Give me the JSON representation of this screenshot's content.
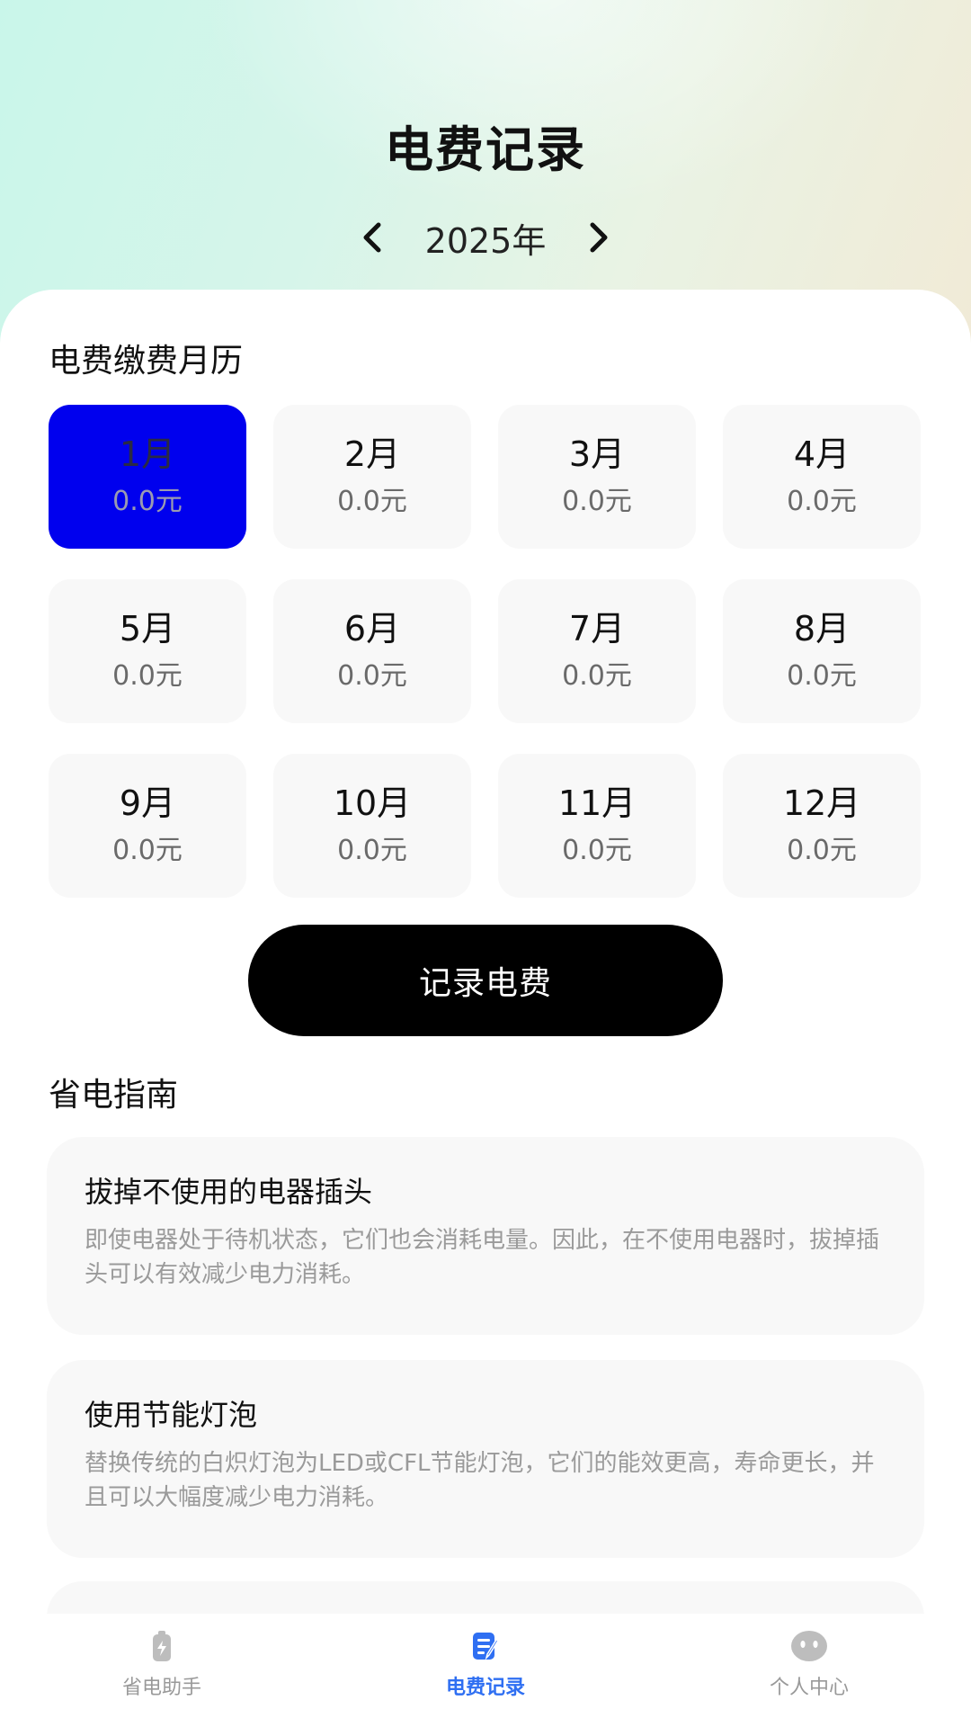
{
  "header": {
    "title": "电费记录",
    "year": "2025年"
  },
  "calendar": {
    "section_title": "电费缴费月历",
    "selected_month": "1月",
    "months": [
      {
        "name": "1月",
        "amount": "0.0元"
      },
      {
        "name": "2月",
        "amount": "0.0元"
      },
      {
        "name": "3月",
        "amount": "0.0元"
      },
      {
        "name": "4月",
        "amount": "0.0元"
      },
      {
        "name": "5月",
        "amount": "0.0元"
      },
      {
        "name": "6月",
        "amount": "0.0元"
      },
      {
        "name": "7月",
        "amount": "0.0元"
      },
      {
        "name": "8月",
        "amount": "0.0元"
      },
      {
        "name": "9月",
        "amount": "0.0元"
      },
      {
        "name": "10月",
        "amount": "0.0元"
      },
      {
        "name": "11月",
        "amount": "0.0元"
      },
      {
        "name": "12月",
        "amount": "0.0元"
      }
    ]
  },
  "record_button": "记录电费",
  "guide": {
    "section_title": "省电指南",
    "tips": [
      {
        "title": "拔掉不使用的电器插头",
        "body": "即使电器处于待机状态，它们也会消耗电量。因此，在不使用电器时，拔掉插头可以有效减少电力消耗。"
      },
      {
        "title": "使用节能灯泡",
        "body": "替换传统的白炽灯泡为LED或CFL节能灯泡，它们的能效更高，寿命更长，并且可以大幅度减少电力消耗。"
      }
    ]
  },
  "tabbar": {
    "tabs": [
      {
        "label": "省电助手",
        "icon": "battery-icon",
        "active": false
      },
      {
        "label": "电费记录",
        "icon": "edit-note-icon",
        "active": true
      },
      {
        "label": "个人中心",
        "icon": "face-icon",
        "active": false
      }
    ]
  },
  "colors": {
    "selected_month": "#0000ee",
    "active_tab": "#2f6ff2",
    "button": "#000000"
  }
}
